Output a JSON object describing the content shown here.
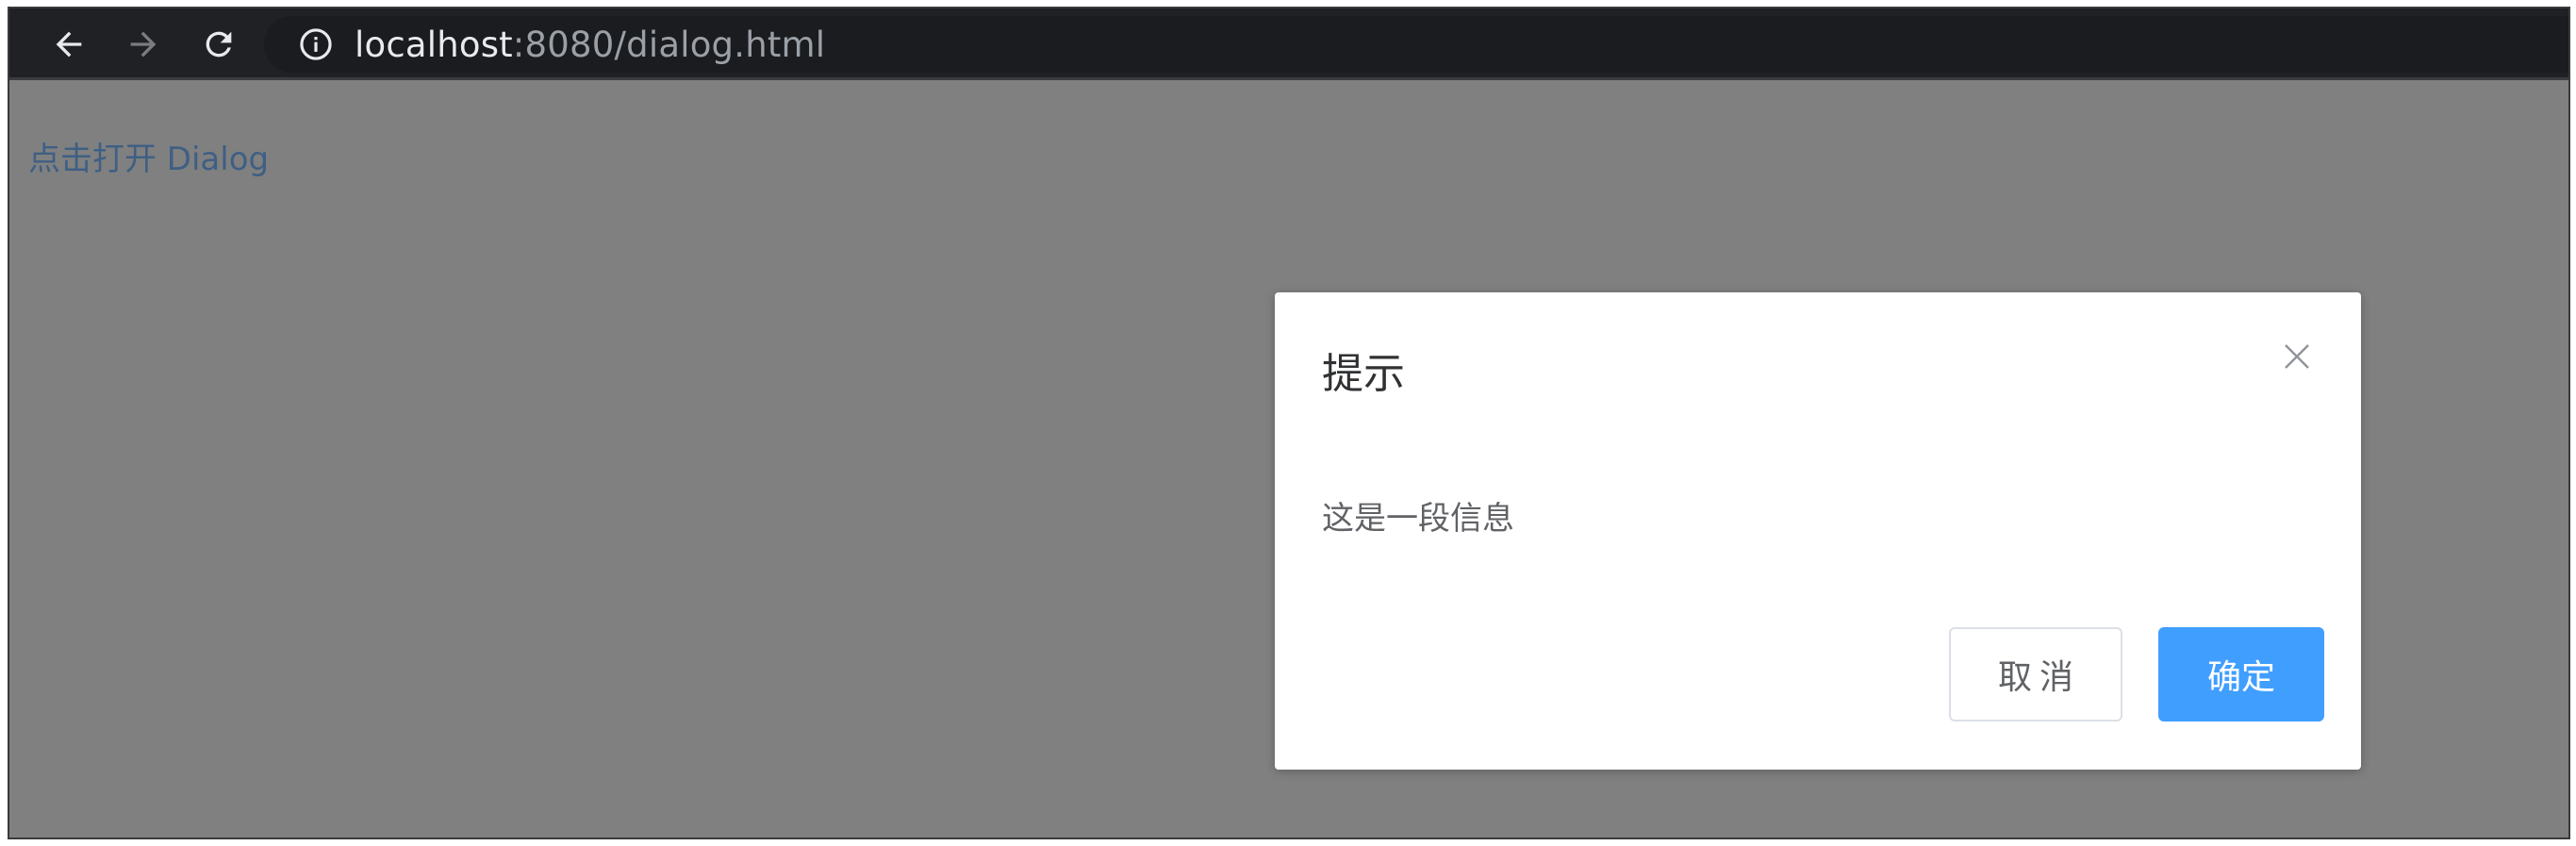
{
  "browser": {
    "url_host": "localhost",
    "url_path": ":8080/dialog.html",
    "back_icon": "back-arrow-icon",
    "forward_icon": "forward-arrow-icon",
    "reload_icon": "reload-icon",
    "site_info_icon": "info-icon"
  },
  "page": {
    "open_link": "点击打开 Dialog"
  },
  "dialog": {
    "title": "提示",
    "message": "这是一段信息",
    "close_icon": "close-icon",
    "cancel_label": "取消",
    "confirm_label": "确定"
  },
  "colors": {
    "toolbar_bg": "#202124",
    "overlay": "#808080",
    "link": "#3f5f84",
    "primary": "#409eff",
    "text": "#303133",
    "muted_text": "#606266"
  }
}
